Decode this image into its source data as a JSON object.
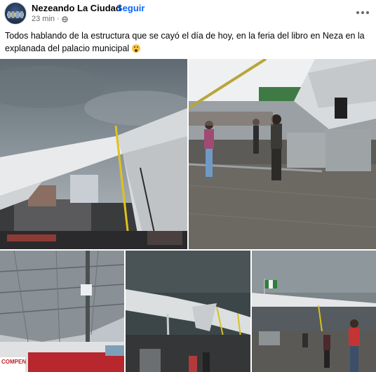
{
  "header": {
    "page_name": "Nezeando La Ciudad",
    "separator": "·",
    "follow_label": "Seguir",
    "timestamp": "23 min",
    "meta_separator": "·",
    "privacy_icon": "globe-icon",
    "more_icon": "more-options-icon"
  },
  "post": {
    "text": "Todos hablando de la estructura que se cayó el día de hoy, en la feria del libro en Neza en la explanada del palacio municipal"
  },
  "photos": {
    "photo_3_banner": "COMPEN"
  },
  "colors": {
    "link": "#0866ff",
    "meta_text": "#65676b"
  }
}
